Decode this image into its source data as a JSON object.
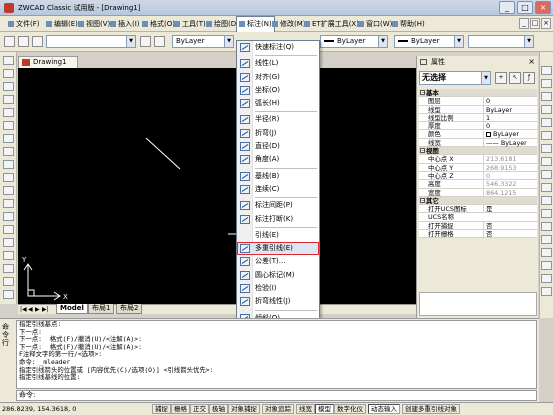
{
  "window": {
    "title": "ZWCAD Classic 试用版 - [Drawing1]",
    "controls": [
      "_",
      "□",
      "×"
    ]
  },
  "menubar": {
    "items": [
      "文件(F)",
      "编辑(E)",
      "视图(V)",
      "插入(I)",
      "格式(O)",
      "工具(T)",
      "绘图(D)",
      "标注(N)",
      "修改(M)",
      "ET扩展工具(X)",
      "窗口(W)",
      "帮助(H)"
    ],
    "active_index": 7,
    "mdi_controls": [
      "_",
      "□",
      "×"
    ]
  },
  "toolbar": {
    "color_combo": "ByLayer",
    "linetype_combo": "ByLayer",
    "lineweight_combo": "ByLayer"
  },
  "document": {
    "tab": "Drawing1"
  },
  "layout_tabs": {
    "nav": [
      "|◀",
      "◀",
      "▶",
      "▶|"
    ],
    "tabs": [
      "Model",
      "布局1",
      "布局2"
    ],
    "selected": 0
  },
  "dimension_menu": {
    "items": [
      {
        "label": "快速标注(Q)",
        "icon": "quick-dimension-icon"
      },
      {
        "sep": true
      },
      {
        "label": "线性(L)",
        "icon": "linear-dimension-icon"
      },
      {
        "label": "对齐(G)",
        "icon": "aligned-dimension-icon"
      },
      {
        "label": "坐标(O)",
        "icon": "ordinate-dimension-icon"
      },
      {
        "label": "弧长(H)",
        "icon": "arc-length-icon"
      },
      {
        "sep": true
      },
      {
        "label": "半径(R)",
        "icon": "radius-icon"
      },
      {
        "label": "折弯(J)",
        "icon": "jogged-icon"
      },
      {
        "label": "直径(D)",
        "icon": "diameter-icon"
      },
      {
        "label": "角度(A)",
        "icon": "angular-icon"
      },
      {
        "sep": true
      },
      {
        "label": "基线(B)",
        "icon": "baseline-icon"
      },
      {
        "label": "连续(C)",
        "icon": "continue-icon"
      },
      {
        "sep": true
      },
      {
        "label": "标注间距(P)",
        "icon": "dimension-space-icon"
      },
      {
        "label": "标注打断(K)",
        "icon": "dimension-break-icon"
      },
      {
        "sep": true
      },
      {
        "label": "引线(E)",
        "icon": ""
      },
      {
        "label": "多重引线(E)",
        "icon": "multileader-icon",
        "highlighted": true
      },
      {
        "label": "公差(T)...",
        "icon": "tolerance-icon"
      },
      {
        "label": "圆心标记(M)",
        "icon": "center-mark-icon"
      },
      {
        "label": "检验(I)",
        "icon": "inspection-icon"
      },
      {
        "label": "折弯线性(J)",
        "icon": "jogged-linear-icon"
      },
      {
        "sep": true
      },
      {
        "label": "倾斜(Q)",
        "icon": "oblique-icon"
      },
      {
        "label": "对齐文字(X)",
        "icon": "",
        "submenu": true
      },
      {
        "sep": true
      },
      {
        "label": "标注样式(S)...",
        "icon": "dimension-style-icon"
      },
      {
        "label": "替代(V)",
        "icon": "override-icon"
      },
      {
        "label": "更新(U)",
        "icon": "update-icon"
      }
    ]
  },
  "properties": {
    "title": "属性",
    "close": "×",
    "selection": "无选择",
    "sections": [
      {
        "name": "基本",
        "rows": [
          {
            "k": "图层",
            "v": "0"
          },
          {
            "k": "线型",
            "v": "ByLayer"
          },
          {
            "k": "线型比例",
            "v": "1"
          },
          {
            "k": "厚度",
            "v": "0"
          },
          {
            "k": "颜色",
            "v": "ByLayer",
            "swatch": true
          },
          {
            "k": "线宽",
            "v": "—— ByLayer"
          }
        ]
      },
      {
        "name": "视图",
        "rows": [
          {
            "k": "中心点 X",
            "v": "213.6181",
            "grey": true
          },
          {
            "k": "中心点 Y",
            "v": "268.9153",
            "grey": true
          },
          {
            "k": "中心点 Z",
            "v": "0",
            "grey": true
          },
          {
            "k": "高度",
            "v": "546.3322",
            "grey": true
          },
          {
            "k": "宽度",
            "v": "864.1215",
            "grey": true
          }
        ]
      },
      {
        "name": "其它",
        "rows": [
          {
            "k": "打开UCS图标",
            "v": "是"
          },
          {
            "k": "UCS名称",
            "v": ""
          },
          {
            "k": "打开捕捉",
            "v": "否"
          },
          {
            "k": "打开栅格",
            "v": "否"
          }
        ]
      }
    ]
  },
  "command": {
    "label": "命令行",
    "history": [
      "指定引线基点:",
      "下一点:",
      "下一点:  格式(F)/撤消(U)/<注解(A)>:",
      "下一点:  格式(F)/撤消(U)/<注解(A)>:",
      "F注释文字的第一行/<选项>:",
      "命令: _mleader",
      "指定引线箭头的位置或 [内容优先(C)/选项(O)] <引线箭头优先>:",
      "指定引线基线的位置:"
    ],
    "prompt": "命令:"
  },
  "statusbar": {
    "coords": "286.8239,  154.3618,  0",
    "toggles": [
      {
        "label": "捕捉",
        "on": false
      },
      {
        "label": "栅格",
        "on": false
      },
      {
        "label": "正交",
        "on": false
      },
      {
        "label": "极轴",
        "on": false
      },
      {
        "label": "对象捕捉",
        "on": false
      },
      {
        "label": "对象追踪",
        "on": false
      },
      {
        "label": "线宽",
        "on": false
      },
      {
        "label": "模型",
        "on": true
      },
      {
        "label": "数字化仪",
        "on": false
      },
      {
        "label": "动态输入",
        "on": true
      },
      {
        "label": "创建多重引线对象",
        "on": false
      }
    ]
  },
  "colors": {
    "canvas": "#000000",
    "highlight_border": "#e1262c",
    "menu_highlight": "#dbe6f4"
  }
}
